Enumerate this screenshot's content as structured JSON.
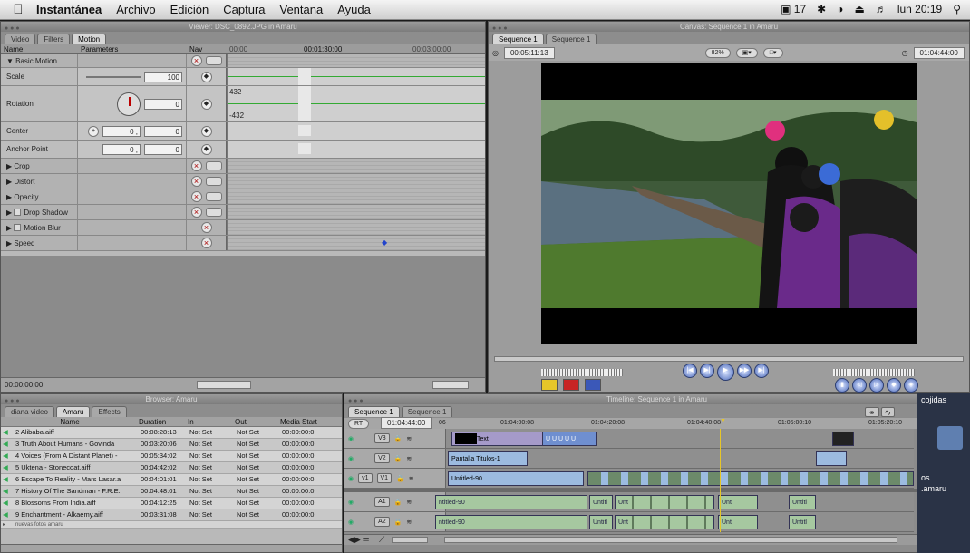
{
  "menubar": {
    "app": "Instantánea",
    "items": [
      "Archivo",
      "Edición",
      "Captura",
      "Ventana",
      "Ayuda"
    ],
    "status": {
      "adobe": "17",
      "clock": "lun 20:19"
    }
  },
  "viewer": {
    "title": "Viewer: DSC_0892.JPG in Amaru",
    "tabs": [
      "Video",
      "Filters",
      "Motion"
    ],
    "cols": {
      "name": "Name",
      "params": "Parameters",
      "nav": "Nav",
      "t0": "00:00",
      "t1": "00:01:30:00",
      "t2": "00:03:00:00"
    },
    "rows": [
      {
        "name": "Basic Motion",
        "val": ""
      },
      {
        "name": "Scale",
        "val": "100"
      },
      {
        "name": "Rotation",
        "val": "0"
      },
      {
        "name": "Center",
        "val": "0 ,",
        "val2": "0"
      },
      {
        "name": "Anchor Point",
        "val": "0 ,",
        "val2": "0"
      },
      {
        "name": "Crop"
      },
      {
        "name": "Distort"
      },
      {
        "name": "Opacity"
      },
      {
        "name": "Drop Shadow"
      },
      {
        "name": "Motion Blur"
      },
      {
        "name": "Speed"
      }
    ],
    "rot_hi": "432",
    "rot_lo": "-432",
    "timecode": "00:00:00;00"
  },
  "canvas": {
    "title": "Canvas: Sequence 1 in Amaru",
    "tabs": [
      "Sequence 1",
      "Sequence 1"
    ],
    "tc_left": "00:05:11:13",
    "zoom": "82%",
    "tc_right": "01:04:44:00"
  },
  "browser": {
    "title": "Browser: Amaru",
    "tabs": [
      "diana video",
      "Amaru",
      "Effects"
    ],
    "cols": [
      "Name",
      "Duration",
      "In",
      "Out",
      "Media Start"
    ],
    "rows": [
      [
        "2 Alibaba.aiff",
        "00:08:28:13",
        "Not Set",
        "Not Set",
        "00:00:00:0"
      ],
      [
        "3 Truth About Humans - Govinda",
        "00:03:20:06",
        "Not Set",
        "Not Set",
        "00:00:00:0"
      ],
      [
        "4 Voices (From A Distant Planet) -",
        "00:05:34:02",
        "Not Set",
        "Not Set",
        "00:00:00:0"
      ],
      [
        "5 Uktena - Stonecoat.aiff",
        "00:04:42:02",
        "Not Set",
        "Not Set",
        "00:00:00:0"
      ],
      [
        "6 Escape To Reality - Mars Lasar.a",
        "00:04:01:01",
        "Not Set",
        "Not Set",
        "00:00:00:0"
      ],
      [
        "7 History Of The Sandman - F.R.E.",
        "00:04:48:01",
        "Not Set",
        "Not Set",
        "00:00:00:0"
      ],
      [
        "8 Blossoms From India.aiff",
        "00:04:12:25",
        "Not Set",
        "Not Set",
        "00:00:00:0"
      ],
      [
        "9 Enchantment - Alkaemy.aiff",
        "00:03:31:08",
        "Not Set",
        "Not Set",
        "00:00:00:0"
      ]
    ],
    "last": "nuevas fotos amaru"
  },
  "timeline": {
    "title": "Timeline: Sequence 1 in Amaru",
    "tabs": [
      "Sequence 1",
      "Sequence 1"
    ],
    "rt": "RT",
    "tc": "01:04:44:00",
    "ruler": [
      "06",
      "01:04:00:08",
      "01:04:20:08",
      "01:04:40:08",
      "01:05:00:10",
      "01:05:20:10"
    ],
    "tracks": [
      "V3",
      "V2",
      "V1",
      "A1",
      "A2"
    ],
    "v1src": "v1",
    "clips": {
      "text": "Text",
      "titulos": "Pantalla Titulos-1",
      "untitled": "Untitled-90",
      "untitled_a": "ntitled-90",
      "short": "Untitl",
      "unt": "Unt"
    }
  },
  "desktop": {
    "l1": "cojidas",
    "l2": "os",
    "l3": ".amaru"
  }
}
